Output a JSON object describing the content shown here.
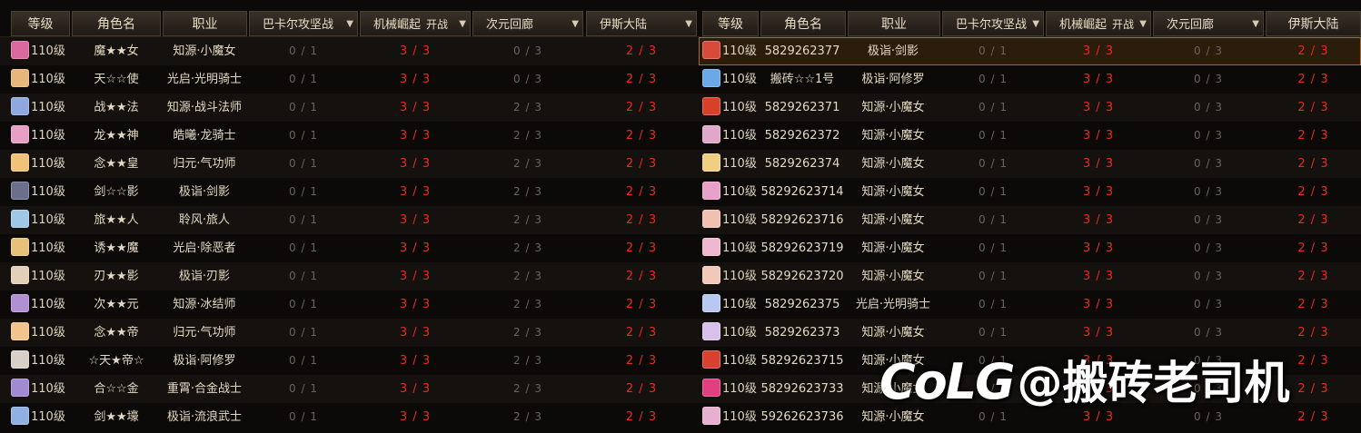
{
  "left_table": {
    "headers": {
      "level": "等级",
      "name": "角色名",
      "job": "职业",
      "raid1": "巴卡尔攻坚战",
      "raid2": "机械崛起",
      "raid2_badge": "开战",
      "raid3": "次元回廊",
      "raid4": "伊斯大陆"
    },
    "rows": [
      {
        "level": "110级",
        "name": "魔★★女",
        "job": "知源·小魔女",
        "r1": "0 / 1",
        "r2": "3 / 3",
        "r3": "0 / 3",
        "r4": "2 / 3",
        "avatar_color": "#d86a9e"
      },
      {
        "level": "110级",
        "name": "天☆☆使",
        "job": "光启·光明骑士",
        "r1": "0 / 1",
        "r2": "3 / 3",
        "r3": "0 / 3",
        "r4": "2 / 3",
        "avatar_color": "#e6b67a"
      },
      {
        "level": "110级",
        "name": "战★★法",
        "job": "知源·战斗法师",
        "r1": "0 / 1",
        "r2": "3 / 3",
        "r3": "2 / 3",
        "r4": "2 / 3",
        "avatar_color": "#8fa8e0"
      },
      {
        "level": "110级",
        "name": "龙★★神",
        "job": "皓曦·龙骑士",
        "r1": "0 / 1",
        "r2": "3 / 3",
        "r3": "2 / 3",
        "r4": "2 / 3",
        "avatar_color": "#e79fc4"
      },
      {
        "level": "110级",
        "name": "念★★皇",
        "job": "归元·气功师",
        "r1": "0 / 1",
        "r2": "3 / 3",
        "r3": "2 / 3",
        "r4": "2 / 3",
        "avatar_color": "#f1c27a"
      },
      {
        "level": "110级",
        "name": "剑☆☆影",
        "job": "极诣·剑影",
        "r1": "0 / 1",
        "r2": "3 / 3",
        "r3": "2 / 3",
        "r4": "2 / 3",
        "avatar_color": "#6b6f8c"
      },
      {
        "level": "110级",
        "name": "旅★★人",
        "job": "聆风·旅人",
        "r1": "0 / 1",
        "r2": "3 / 3",
        "r3": "2 / 3",
        "r4": "2 / 3",
        "avatar_color": "#9ec8e6"
      },
      {
        "level": "110级",
        "name": "诱★★魔",
        "job": "光启·除恶者",
        "r1": "0 / 1",
        "r2": "3 / 3",
        "r3": "2 / 3",
        "r4": "2 / 3",
        "avatar_color": "#e8c07a"
      },
      {
        "level": "110级",
        "name": "刃★★影",
        "job": "极诣·刃影",
        "r1": "0 / 1",
        "r2": "3 / 3",
        "r3": "2 / 3",
        "r4": "2 / 3",
        "avatar_color": "#e2d0b8"
      },
      {
        "level": "110级",
        "name": "次★★元",
        "job": "知源·冰结师",
        "r1": "0 / 1",
        "r2": "3 / 3",
        "r3": "2 / 3",
        "r4": "2 / 3",
        "avatar_color": "#b090d0"
      },
      {
        "level": "110级",
        "name": "念★★帝",
        "job": "归元·气功师",
        "r1": "0 / 1",
        "r2": "3 / 3",
        "r3": "2 / 3",
        "r4": "2 / 3",
        "avatar_color": "#f0c48c"
      },
      {
        "level": "110级",
        "name": "☆天★帝☆",
        "job": "极诣·阿修罗",
        "r1": "0 / 1",
        "r2": "3 / 3",
        "r3": "2 / 3",
        "r4": "2 / 3",
        "avatar_color": "#d8d0c8"
      },
      {
        "level": "110级",
        "name": "合☆☆金",
        "job": "重霄·合金战士",
        "r1": "0 / 1",
        "r2": "3 / 3",
        "r3": "2 / 3",
        "r4": "2 / 3",
        "avatar_color": "#a08ad0"
      },
      {
        "level": "110级",
        "name": "剑★★壕",
        "job": "极诣·流浪武士",
        "r1": "0 / 1",
        "r2": "3 / 3",
        "r3": "2 / 3",
        "r4": "2 / 3",
        "avatar_color": "#8fb0e0"
      }
    ]
  },
  "right_table": {
    "headers": {
      "level": "等级",
      "name": "角色名",
      "job": "职业",
      "raid1": "巴卡尔攻坚战",
      "raid2": "机械崛起",
      "raid2_badge": "开战",
      "raid3": "次元回廊",
      "raid4": "伊斯大陆"
    },
    "rows": [
      {
        "level": "110级",
        "name": "5829262377",
        "job": "极诣·剑影",
        "r1": "0 / 1",
        "r2": "3 / 3",
        "r3": "0 / 3",
        "r4": "2 / 3",
        "avatar_color": "#d84a3a",
        "selected": true
      },
      {
        "level": "110级",
        "name": "搬砖☆☆1号",
        "job": "极诣·阿修罗",
        "r1": "0 / 1",
        "r2": "3 / 3",
        "r3": "0 / 3",
        "r4": "2 / 3",
        "avatar_color": "#6aa8e8"
      },
      {
        "level": "110级",
        "name": "5829262371",
        "job": "知源·小魔女",
        "r1": "0 / 1",
        "r2": "3 / 3",
        "r3": "0 / 3",
        "r4": "2 / 3",
        "avatar_color": "#d8402a"
      },
      {
        "level": "110级",
        "name": "5829262372",
        "job": "知源·小魔女",
        "r1": "0 / 1",
        "r2": "3 / 3",
        "r3": "0 / 3",
        "r4": "2 / 3",
        "avatar_color": "#e0a8c8"
      },
      {
        "level": "110级",
        "name": "5829262374",
        "job": "知源·小魔女",
        "r1": "0 / 1",
        "r2": "3 / 3",
        "r3": "0 / 3",
        "r4": "2 / 3",
        "avatar_color": "#f0d080"
      },
      {
        "level": "110级",
        "name": "58292623714",
        "job": "知源·小魔女",
        "r1": "0 / 1",
        "r2": "3 / 3",
        "r3": "0 / 3",
        "r4": "2 / 3",
        "avatar_color": "#e8a0c8"
      },
      {
        "level": "110级",
        "name": "58292623716",
        "job": "知源·小魔女",
        "r1": "0 / 1",
        "r2": "3 / 3",
        "r3": "0 / 3",
        "r4": "2 / 3",
        "avatar_color": "#f0c0b0"
      },
      {
        "level": "110级",
        "name": "58292623719",
        "job": "知源·小魔女",
        "r1": "0 / 1",
        "r2": "3 / 3",
        "r3": "0 / 3",
        "r4": "2 / 3",
        "avatar_color": "#f0b8d0"
      },
      {
        "level": "110级",
        "name": "58292623720",
        "job": "知源·小魔女",
        "r1": "0 / 1",
        "r2": "3 / 3",
        "r3": "0 / 3",
        "r4": "2 / 3",
        "avatar_color": "#f2c8b8"
      },
      {
        "level": "110级",
        "name": "5829262375",
        "job": "光启·光明骑士",
        "r1": "0 / 1",
        "r2": "3 / 3",
        "r3": "0 / 3",
        "r4": "2 / 3",
        "avatar_color": "#b8c8f0"
      },
      {
        "level": "110级",
        "name": "5829262373",
        "job": "知源·小魔女",
        "r1": "0 / 1",
        "r2": "3 / 3",
        "r3": "0 / 3",
        "r4": "2 / 3",
        "avatar_color": "#d8c0e8"
      },
      {
        "level": "110级",
        "name": "58292623715",
        "job": "知源·小魔女",
        "r1": "0 / 1",
        "r2": "3 / 3",
        "r3": "0 / 3",
        "r4": "2 / 3",
        "avatar_color": "#d84030"
      },
      {
        "level": "110级",
        "name": "58292623733",
        "job": "知源·小魔女",
        "r1": "0 / 1",
        "r2": "3 / 3",
        "r3": "0 / 3",
        "r4": "2 / 3",
        "avatar_color": "#e04080"
      },
      {
        "level": "110级",
        "name": "59262623736",
        "job": "知源·小魔女",
        "r1": "0 / 1",
        "r2": "3 / 3",
        "r3": "0 / 3",
        "r4": "2 / 3",
        "avatar_color": "#e8b0d0"
      }
    ]
  },
  "watermark": {
    "logo": "CoLG",
    "text": "@搬砖老司机"
  },
  "colors": {
    "done_red": "#e82a1e",
    "pending_grey": "#6b635b",
    "selected_border": "#a86a20"
  }
}
